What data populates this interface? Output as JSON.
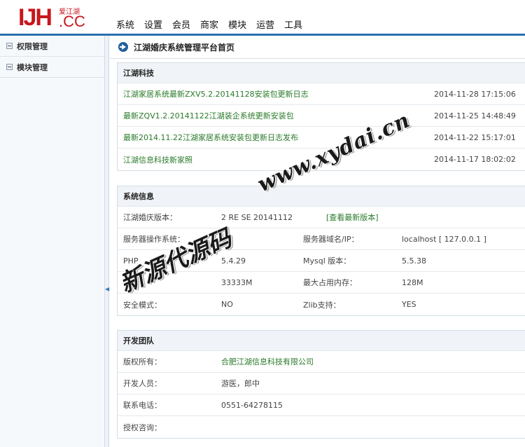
{
  "logo": {
    "main": "IJH",
    "suffix": ".CC",
    "cn": "爱江湖"
  },
  "topnav": [
    "系统",
    "设置",
    "会员",
    "商家",
    "模块",
    "运营",
    "工具"
  ],
  "sidebar": {
    "items": [
      {
        "label": "权限管理"
      },
      {
        "label": "模块管理"
      }
    ]
  },
  "page": {
    "title": "江湖婚庆系统管理平台首页"
  },
  "news": {
    "title": "江湖科技",
    "items": [
      {
        "text": "江湖家居系统最新ZXV5.2.20141128安装包更新日志",
        "date": "2014-11-28 17:15:06"
      },
      {
        "text": "最新ZQV1.2.20141122江湖装企系统更新安装包",
        "date": "2014-11-25 14:48:49"
      },
      {
        "text": "最新2014.11.22江湖家居系统安装包更新日志发布",
        "date": "2014-11-22 15:17:01"
      },
      {
        "text": "江湖信息科技新家照",
        "date": "2014-11-17 18:02:02"
      }
    ]
  },
  "sysinfo": {
    "title": "系统信息",
    "version_label": "江湖婚庆版本：",
    "version_value": "2 RE    SE 20141112",
    "version_link": "[查看最新版本]",
    "rows": [
      {
        "l1": "服务器操作系统：",
        "v1": "",
        "l2": "服务器域名/IP：",
        "v2": "localhost [ 127.0.0.1 ]"
      },
      {
        "l1": "PHP",
        "v1": "5.4.29",
        "l2": "Mysql 版本：",
        "v2": "5.5.38"
      },
      {
        "l1": "",
        "v1": "33333M",
        "l2": "最大占用内存：",
        "v2": "128M"
      },
      {
        "l1": "安全模式：",
        "v1": "NO",
        "l2": "Zlib支持：",
        "v2": "YES"
      }
    ]
  },
  "team": {
    "title": "开发团队",
    "rows": [
      {
        "label": "版权所有：",
        "value": "合肥江湖信息科技有限公司",
        "link": true
      },
      {
        "label": "开发人员：",
        "value": "游医，郎中",
        "link": false
      },
      {
        "label": "联系电话：",
        "value": "0551-64278115",
        "link": false
      },
      {
        "label": "授权咨询：",
        "value": "",
        "link": false
      }
    ]
  },
  "watermark": {
    "url": "www.xydai.cn",
    "cn": "新源代源码"
  }
}
